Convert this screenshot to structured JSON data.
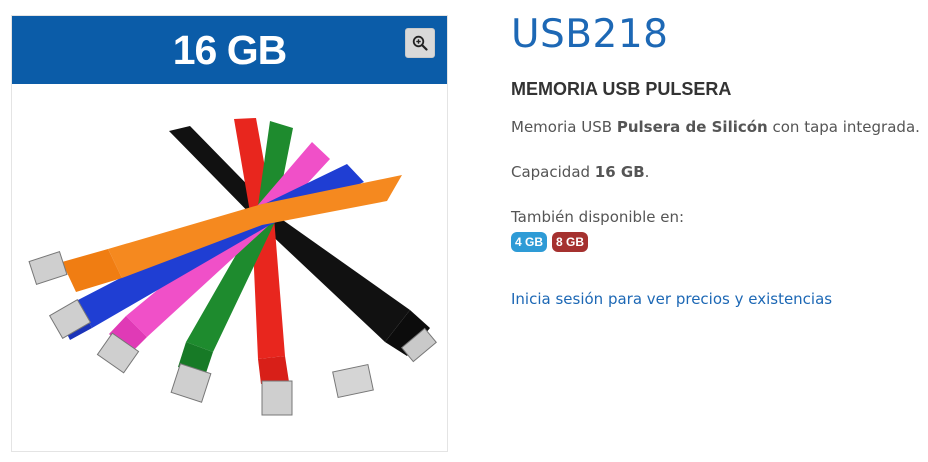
{
  "product": {
    "banner": "16 GB",
    "sku": "USB218",
    "name": "MEMORIA USB PULSERA",
    "description": {
      "prefix": "Memoria USB ",
      "bold": "Pulsera de Silicón",
      "suffix": " con tapa integrada."
    },
    "capacity": {
      "prefix": "Capacidad ",
      "bold": "16 GB",
      "suffix": "."
    },
    "also_available_label": "También disponible en:",
    "variants": [
      {
        "label": "4 GB",
        "color": "#2e9bd6"
      },
      {
        "label": "8 GB",
        "color": "#a5312f"
      }
    ],
    "login_link": "Inicia sesión para ver precios y existencias"
  },
  "icons": {
    "zoom": "zoom-in-icon"
  },
  "colors": {
    "accent": "#1d68b5",
    "banner": "#0b5ca8",
    "bracelets": [
      "#f5891f",
      "#1f3ed3",
      "#f050c8",
      "#1e8b2e",
      "#e8261e",
      "#1a1a1a"
    ]
  }
}
